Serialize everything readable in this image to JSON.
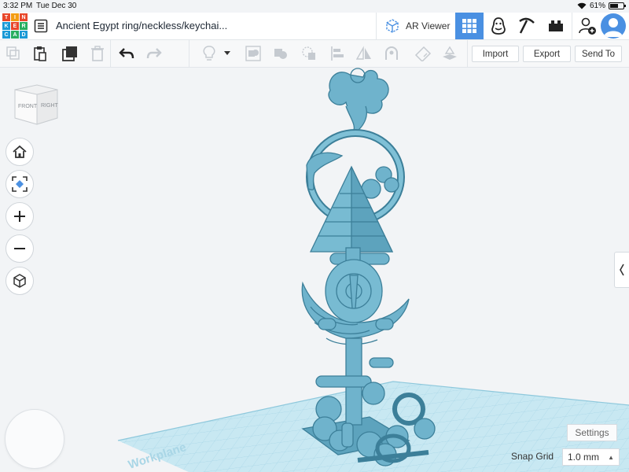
{
  "status_bar": {
    "time": "3:32 PM",
    "date": "Tue Dec 30",
    "battery": "61%",
    "battery_level": 0.61
  },
  "header": {
    "logo_letters": [
      "T",
      "I",
      "N",
      "K",
      "E",
      "R",
      "C",
      "A",
      "D"
    ],
    "logo_colors": [
      "#e8472b",
      "#f39c12",
      "#e8472b",
      "#1b9ad6",
      "#e8472b",
      "#27ae60",
      "#1b9ad6",
      "#27ae60",
      "#1b9ad6"
    ],
    "design_title": "Ancient Egypt ring/neckless/keychai...",
    "ar_viewer_label": "AR Viewer"
  },
  "toolbar": {
    "import_label": "Import",
    "export_label": "Export",
    "send_to_label": "Send To"
  },
  "viewcube": {
    "front_label": "FRONT",
    "right_label": "RIGHT"
  },
  "workplane": {
    "label": "Workplane",
    "settings_label": "Settings",
    "snap_grid_label": "Snap Grid",
    "snap_grid_value": "1.0 mm"
  },
  "colors": {
    "accent": "#4a90e2",
    "model": "#6fb3cc",
    "model_dark": "#3c7f99",
    "workplane": "#bfe4f0"
  }
}
